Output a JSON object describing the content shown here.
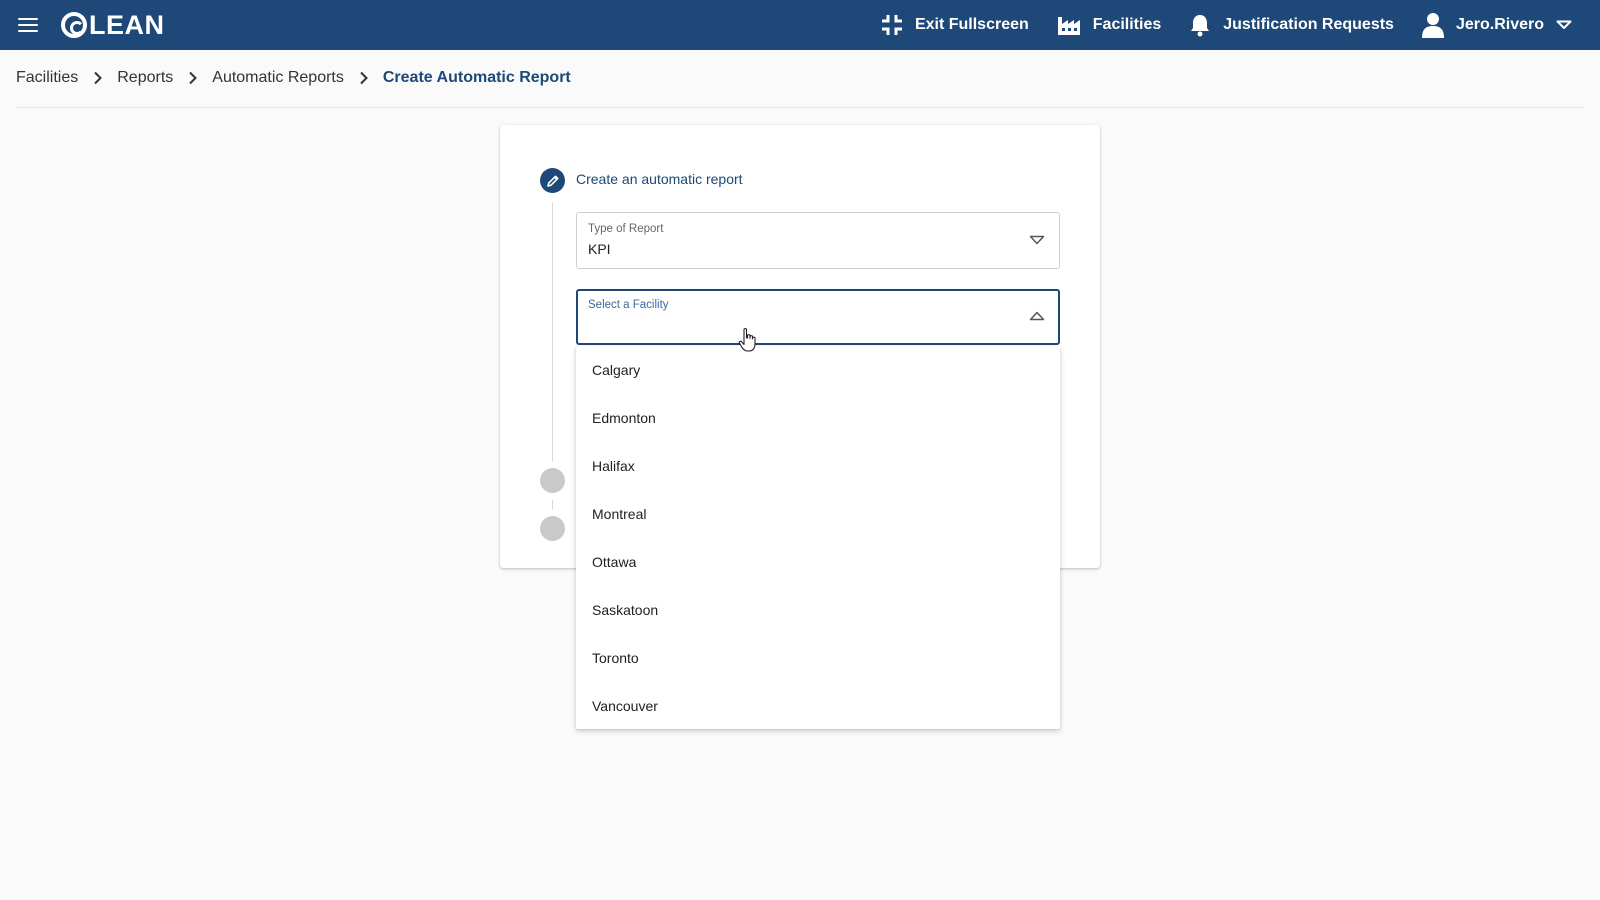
{
  "app": {
    "logo_text": "LEAN",
    "brand_color": "#1d4877"
  },
  "header": {
    "menu_icon": "hamburger-icon",
    "nav": {
      "exit_fullscreen": "Exit Fullscreen",
      "facilities": "Facilities",
      "justification_requests": "Justification Requests",
      "user": "Jero.Rivero"
    }
  },
  "breadcrumb": {
    "items": [
      "Facilities",
      "Reports",
      "Automatic Reports",
      "Create Automatic Report"
    ]
  },
  "form": {
    "step_title": "Create an automatic report",
    "type_of_report": {
      "label": "Type of Report",
      "value": "KPI"
    },
    "facility": {
      "label": "Select a Facility",
      "value": ""
    }
  },
  "dropdown": {
    "options": [
      "Calgary",
      "Edmonton",
      "Halifax",
      "Montreal",
      "Ottawa",
      "Saskatoon",
      "Toronto",
      "Vancouver"
    ]
  }
}
